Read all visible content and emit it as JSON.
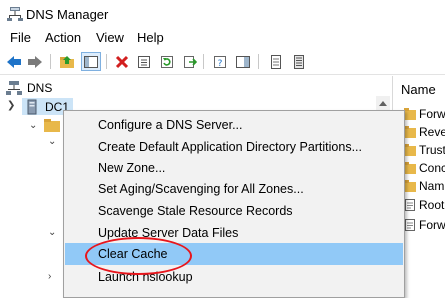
{
  "window": {
    "title": "DNS Manager"
  },
  "menu": [
    "File",
    "Action",
    "View",
    "Help"
  ],
  "toolbar": {
    "buttons": [
      "back-icon",
      "forward-icon",
      "up-folder-icon",
      "show-hide-tree-icon",
      "delete-icon",
      "properties-icon",
      "refresh-icon",
      "export-list-icon",
      "help-icon",
      "console-pane-icon",
      "list-icon",
      "details-icon"
    ]
  },
  "tree": {
    "root_label": "DNS",
    "server_label": "DC1"
  },
  "right_pane": {
    "header": "Name",
    "items": [
      "Forw",
      "Reve",
      "Trust",
      "Conc",
      "Nam",
      "Root",
      "Forw"
    ]
  },
  "context_menu": {
    "items": [
      "Configure a DNS Server...",
      "Create Default Application Directory Partitions...",
      "New Zone...",
      "Set Aging/Scavenging for All Zones...",
      "Scavenge Stale Resource Records",
      "Update Server Data Files",
      "Clear Cache",
      "Launch nslookup"
    ],
    "highlighted": "Clear Cache"
  },
  "colors": {
    "highlight": "#91c9f7",
    "annotation": "#e8161c"
  }
}
